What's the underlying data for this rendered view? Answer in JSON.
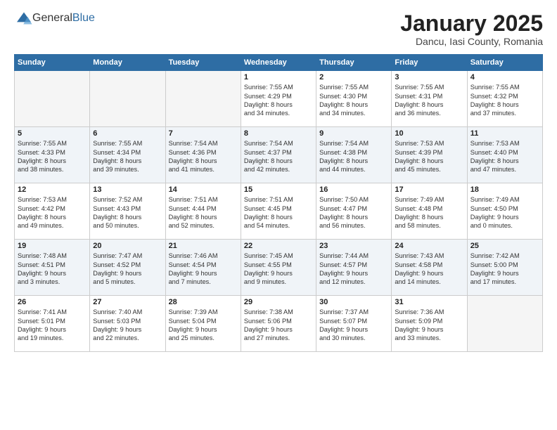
{
  "logo": {
    "general": "General",
    "blue": "Blue"
  },
  "header": {
    "title": "January 2025",
    "subtitle": "Dancu, Iasi County, Romania"
  },
  "days_of_week": [
    "Sunday",
    "Monday",
    "Tuesday",
    "Wednesday",
    "Thursday",
    "Friday",
    "Saturday"
  ],
  "weeks": [
    [
      {
        "day": "",
        "info": ""
      },
      {
        "day": "",
        "info": ""
      },
      {
        "day": "",
        "info": ""
      },
      {
        "day": "1",
        "info": "Sunrise: 7:55 AM\nSunset: 4:29 PM\nDaylight: 8 hours\nand 34 minutes."
      },
      {
        "day": "2",
        "info": "Sunrise: 7:55 AM\nSunset: 4:30 PM\nDaylight: 8 hours\nand 34 minutes."
      },
      {
        "day": "3",
        "info": "Sunrise: 7:55 AM\nSunset: 4:31 PM\nDaylight: 8 hours\nand 36 minutes."
      },
      {
        "day": "4",
        "info": "Sunrise: 7:55 AM\nSunset: 4:32 PM\nDaylight: 8 hours\nand 37 minutes."
      }
    ],
    [
      {
        "day": "5",
        "info": "Sunrise: 7:55 AM\nSunset: 4:33 PM\nDaylight: 8 hours\nand 38 minutes."
      },
      {
        "day": "6",
        "info": "Sunrise: 7:55 AM\nSunset: 4:34 PM\nDaylight: 8 hours\nand 39 minutes."
      },
      {
        "day": "7",
        "info": "Sunrise: 7:54 AM\nSunset: 4:36 PM\nDaylight: 8 hours\nand 41 minutes."
      },
      {
        "day": "8",
        "info": "Sunrise: 7:54 AM\nSunset: 4:37 PM\nDaylight: 8 hours\nand 42 minutes."
      },
      {
        "day": "9",
        "info": "Sunrise: 7:54 AM\nSunset: 4:38 PM\nDaylight: 8 hours\nand 44 minutes."
      },
      {
        "day": "10",
        "info": "Sunrise: 7:53 AM\nSunset: 4:39 PM\nDaylight: 8 hours\nand 45 minutes."
      },
      {
        "day": "11",
        "info": "Sunrise: 7:53 AM\nSunset: 4:40 PM\nDaylight: 8 hours\nand 47 minutes."
      }
    ],
    [
      {
        "day": "12",
        "info": "Sunrise: 7:53 AM\nSunset: 4:42 PM\nDaylight: 8 hours\nand 49 minutes."
      },
      {
        "day": "13",
        "info": "Sunrise: 7:52 AM\nSunset: 4:43 PM\nDaylight: 8 hours\nand 50 minutes."
      },
      {
        "day": "14",
        "info": "Sunrise: 7:51 AM\nSunset: 4:44 PM\nDaylight: 8 hours\nand 52 minutes."
      },
      {
        "day": "15",
        "info": "Sunrise: 7:51 AM\nSunset: 4:45 PM\nDaylight: 8 hours\nand 54 minutes."
      },
      {
        "day": "16",
        "info": "Sunrise: 7:50 AM\nSunset: 4:47 PM\nDaylight: 8 hours\nand 56 minutes."
      },
      {
        "day": "17",
        "info": "Sunrise: 7:49 AM\nSunset: 4:48 PM\nDaylight: 8 hours\nand 58 minutes."
      },
      {
        "day": "18",
        "info": "Sunrise: 7:49 AM\nSunset: 4:50 PM\nDaylight: 9 hours\nand 0 minutes."
      }
    ],
    [
      {
        "day": "19",
        "info": "Sunrise: 7:48 AM\nSunset: 4:51 PM\nDaylight: 9 hours\nand 3 minutes."
      },
      {
        "day": "20",
        "info": "Sunrise: 7:47 AM\nSunset: 4:52 PM\nDaylight: 9 hours\nand 5 minutes."
      },
      {
        "day": "21",
        "info": "Sunrise: 7:46 AM\nSunset: 4:54 PM\nDaylight: 9 hours\nand 7 minutes."
      },
      {
        "day": "22",
        "info": "Sunrise: 7:45 AM\nSunset: 4:55 PM\nDaylight: 9 hours\nand 9 minutes."
      },
      {
        "day": "23",
        "info": "Sunrise: 7:44 AM\nSunset: 4:57 PM\nDaylight: 9 hours\nand 12 minutes."
      },
      {
        "day": "24",
        "info": "Sunrise: 7:43 AM\nSunset: 4:58 PM\nDaylight: 9 hours\nand 14 minutes."
      },
      {
        "day": "25",
        "info": "Sunrise: 7:42 AM\nSunset: 5:00 PM\nDaylight: 9 hours\nand 17 minutes."
      }
    ],
    [
      {
        "day": "26",
        "info": "Sunrise: 7:41 AM\nSunset: 5:01 PM\nDaylight: 9 hours\nand 19 minutes."
      },
      {
        "day": "27",
        "info": "Sunrise: 7:40 AM\nSunset: 5:03 PM\nDaylight: 9 hours\nand 22 minutes."
      },
      {
        "day": "28",
        "info": "Sunrise: 7:39 AM\nSunset: 5:04 PM\nDaylight: 9 hours\nand 25 minutes."
      },
      {
        "day": "29",
        "info": "Sunrise: 7:38 AM\nSunset: 5:06 PM\nDaylight: 9 hours\nand 27 minutes."
      },
      {
        "day": "30",
        "info": "Sunrise: 7:37 AM\nSunset: 5:07 PM\nDaylight: 9 hours\nand 30 minutes."
      },
      {
        "day": "31",
        "info": "Sunrise: 7:36 AM\nSunset: 5:09 PM\nDaylight: 9 hours\nand 33 minutes."
      },
      {
        "day": "",
        "info": ""
      }
    ]
  ]
}
